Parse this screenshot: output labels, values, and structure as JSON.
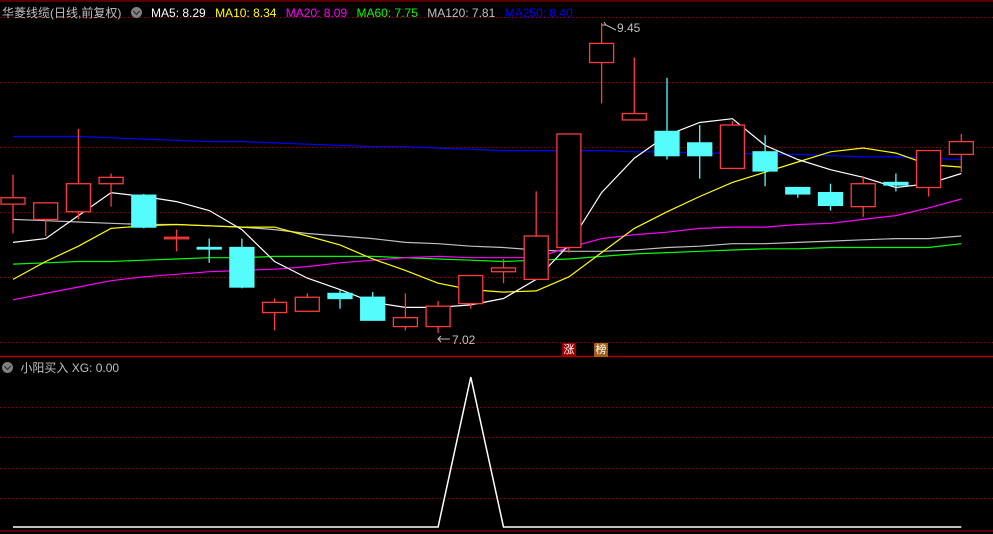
{
  "header": {
    "title": "华菱线缆(日线,前复权)",
    "ma5": "MA5: 8.29",
    "ma10": "MA10: 8.34",
    "ma20": "MA20: 8.09",
    "ma60": "MA60: 7.75",
    "ma120": "MA120: 7.81",
    "ma250": "MA250: 8.40"
  },
  "annotations": {
    "high": "9.45",
    "low": "7.02"
  },
  "tags": {
    "zhang": "涨",
    "bang": "榜"
  },
  "indicator": {
    "title": "小阳买入",
    "value": "XG: 0.00"
  },
  "colors": {
    "up": "#ff3b3b",
    "down": "#54fcfc",
    "ma5": "#ffffff",
    "ma10": "#ffff00",
    "ma20": "#ff00ff",
    "ma60": "#00ff00",
    "ma120": "#c0c0c0",
    "ma250": "#0000ff",
    "grid": "#a00000"
  },
  "chart_data": [
    {
      "type": "candlestick",
      "title": "华菱线缆(日线,前复权)",
      "ylim": [
        7.02,
        9.45
      ],
      "candles": [
        [
          8.03,
          8.26,
          7.8,
          8.08
        ],
        [
          7.91,
          8.04,
          7.78,
          8.04
        ],
        [
          7.97,
          8.62,
          7.91,
          8.19
        ],
        [
          8.19,
          8.27,
          8.01,
          8.24
        ],
        [
          8.1,
          8.11,
          7.84,
          7.85
        ],
        [
          7.77,
          7.83,
          7.66,
          7.77
        ],
        [
          7.69,
          7.76,
          7.57,
          7.68
        ],
        [
          7.69,
          7.76,
          7.37,
          7.38
        ],
        [
          7.18,
          7.29,
          7.04,
          7.26
        ],
        [
          7.19,
          7.33,
          7.19,
          7.3
        ],
        [
          7.33,
          7.36,
          7.21,
          7.29
        ],
        [
          7.3,
          7.34,
          7.12,
          7.12
        ],
        [
          7.07,
          7.33,
          7.04,
          7.14
        ],
        [
          7.07,
          7.27,
          7.02,
          7.23
        ],
        [
          7.25,
          7.47,
          7.21,
          7.47
        ],
        [
          7.5,
          7.6,
          7.41,
          7.53
        ],
        [
          7.44,
          8.13,
          7.44,
          7.78
        ],
        [
          7.69,
          8.58,
          7.65,
          8.58
        ],
        [
          9.14,
          9.45,
          8.82,
          9.29
        ],
        [
          8.69,
          9.18,
          8.69,
          8.74
        ],
        [
          8.6,
          9.02,
          8.38,
          8.41
        ],
        [
          8.51,
          8.65,
          8.23,
          8.41
        ],
        [
          8.31,
          8.68,
          8.31,
          8.65
        ],
        [
          8.44,
          8.57,
          8.17,
          8.29
        ],
        [
          8.16,
          8.16,
          8.08,
          8.11
        ],
        [
          8.12,
          8.19,
          7.98,
          8.02
        ],
        [
          8.01,
          8.25,
          7.93,
          8.19
        ],
        [
          8.2,
          8.27,
          8.13,
          8.18
        ],
        [
          8.16,
          8.45,
          8.09,
          8.45
        ],
        [
          8.42,
          8.58,
          8.28,
          8.52
        ]
      ],
      "series": [
        {
          "name": "MA5",
          "values": [
            7.73,
            7.76,
            7.94,
            8.12,
            8.09,
            8.05,
            7.98,
            7.83,
            7.58,
            7.45,
            7.36,
            7.26,
            7.22,
            7.22,
            7.24,
            7.29,
            7.44,
            7.71,
            8.12,
            8.39,
            8.57,
            8.67,
            8.7,
            8.49,
            8.38,
            8.3,
            8.24,
            8.16,
            8.19,
            8.27
          ]
        },
        {
          "name": "MA10",
          "values": [
            7.44,
            7.58,
            7.7,
            7.84,
            7.86,
            7.87,
            7.86,
            7.85,
            7.85,
            7.78,
            7.71,
            7.6,
            7.51,
            7.41,
            7.36,
            7.34,
            7.35,
            7.46,
            7.65,
            7.84,
            7.97,
            8.09,
            8.2,
            8.28,
            8.36,
            8.44,
            8.47,
            8.43,
            8.34,
            8.32
          ]
        },
        {
          "name": "MA20",
          "values": [
            7.28,
            7.33,
            7.38,
            7.43,
            7.46,
            7.48,
            7.5,
            7.51,
            7.52,
            7.54,
            7.57,
            7.59,
            7.61,
            7.62,
            7.61,
            7.61,
            7.61,
            7.69,
            7.76,
            7.79,
            7.81,
            7.84,
            7.85,
            7.85,
            7.87,
            7.88,
            7.91,
            7.94,
            8.0,
            8.07
          ]
        },
        {
          "name": "MA60",
          "values": [
            7.56,
            7.57,
            7.58,
            7.58,
            7.59,
            7.6,
            7.61,
            7.61,
            7.62,
            7.62,
            7.62,
            7.62,
            7.61,
            7.6,
            7.59,
            7.58,
            7.59,
            7.6,
            7.62,
            7.64,
            7.65,
            7.66,
            7.67,
            7.68,
            7.68,
            7.69,
            7.69,
            7.69,
            7.69,
            7.72
          ]
        },
        {
          "name": "MA120",
          "values": [
            7.91,
            7.9,
            7.89,
            7.88,
            7.87,
            7.87,
            7.86,
            7.85,
            7.83,
            7.8,
            7.78,
            7.76,
            7.73,
            7.72,
            7.7,
            7.69,
            7.67,
            7.66,
            7.66,
            7.67,
            7.69,
            7.7,
            7.72,
            7.72,
            7.73,
            7.74,
            7.75,
            7.76,
            7.76,
            7.78
          ]
        },
        {
          "name": "MA250",
          "values": [
            8.56,
            8.56,
            8.56,
            8.55,
            8.54,
            8.53,
            8.52,
            8.52,
            8.51,
            8.5,
            8.49,
            8.48,
            8.48,
            8.47,
            8.46,
            8.45,
            8.45,
            8.45,
            8.45,
            8.44,
            8.44,
            8.43,
            8.43,
            8.42,
            8.42,
            8.41,
            8.4,
            8.4,
            8.39,
            8.38
          ]
        }
      ]
    },
    {
      "type": "line",
      "title": "小阳买入",
      "series": [
        {
          "name": "XG",
          "values": [
            0,
            0,
            0,
            0,
            0,
            0,
            0,
            0,
            0,
            0,
            0,
            0,
            0,
            0,
            1,
            0,
            0,
            0,
            0,
            0,
            0,
            0,
            0,
            0,
            0,
            0,
            0,
            0,
            0,
            0
          ]
        }
      ],
      "ylim": [
        0,
        1
      ]
    }
  ]
}
